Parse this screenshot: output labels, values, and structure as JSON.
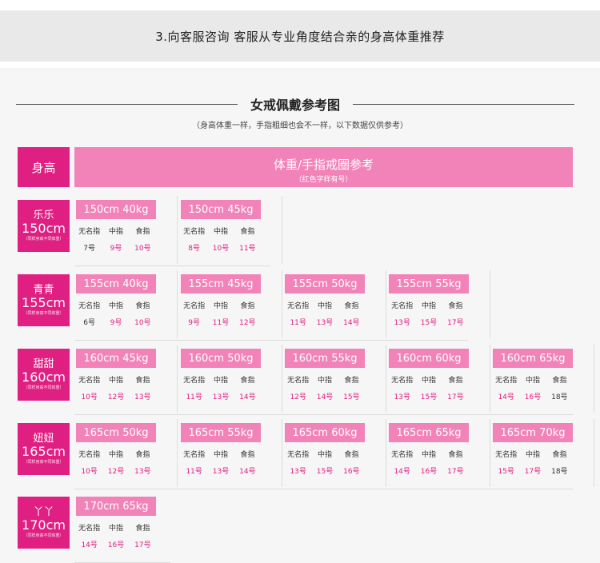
{
  "header": {
    "title": "3.向客服咨询 客服从专业角度结合亲的身高体重推荐"
  },
  "chart": {
    "title": "女戒佩戴参考图",
    "subtitle": "（身高体重一样，手指粗细也会不一样，以下数据仅供参考）",
    "head_left": "身高",
    "head_right": "体重/手指戒圈参考",
    "head_right_sub": "（红色字样有号）",
    "finger_labels": [
      "无名指",
      "中指",
      "食指"
    ],
    "rows": [
      {
        "name": "乐乐",
        "height": "150cm",
        "note": "（同样身高不同体重）",
        "cells": [
          {
            "tag": "150cm 40kg",
            "values": [
              "7号",
              "9号",
              "10号"
            ],
            "red": [
              false,
              true,
              true
            ]
          },
          {
            "tag": "150cm 45kg",
            "values": [
              "8号",
              "10号",
              "11号"
            ],
            "red": [
              true,
              true,
              true
            ]
          }
        ]
      },
      {
        "name": "青青",
        "height": "155cm",
        "note": "（同样身高不同体重）",
        "cells": [
          {
            "tag": "155cm 40kg",
            "values": [
              "6号",
              "9号",
              "10号"
            ],
            "red": [
              false,
              true,
              true
            ]
          },
          {
            "tag": "155cm 45kg",
            "values": [
              "9号",
              "11号",
              "12号"
            ],
            "red": [
              true,
              true,
              true
            ]
          },
          {
            "tag": "155cm 50kg",
            "values": [
              "11号",
              "13号",
              "14号"
            ],
            "red": [
              true,
              true,
              true
            ]
          },
          {
            "tag": "155cm 55kg",
            "values": [
              "13号",
              "15号",
              "17号"
            ],
            "red": [
              true,
              true,
              true
            ]
          }
        ]
      },
      {
        "name": "甜甜",
        "height": "160cm",
        "note": "（同样身高不同体重）",
        "cells": [
          {
            "tag": "160cm 45kg",
            "values": [
              "10号",
              "12号",
              "13号"
            ],
            "red": [
              true,
              true,
              true
            ]
          },
          {
            "tag": "160cm 50kg",
            "values": [
              "11号",
              "13号",
              "14号"
            ],
            "red": [
              true,
              true,
              true
            ]
          },
          {
            "tag": "160cm 55kg",
            "values": [
              "12号",
              "14号",
              "15号"
            ],
            "red": [
              true,
              true,
              true
            ]
          },
          {
            "tag": "160cm 60kg",
            "values": [
              "13号",
              "15号",
              "17号"
            ],
            "red": [
              true,
              true,
              true
            ]
          },
          {
            "tag": "160cm 65kg",
            "values": [
              "14号",
              "16号",
              "18号"
            ],
            "red": [
              true,
              true,
              false
            ]
          }
        ]
      },
      {
        "name": "妞妞",
        "height": "165cm",
        "note": "（同样身高不同体重）",
        "cells": [
          {
            "tag": "165cm 50kg",
            "values": [
              "10号",
              "12号",
              "13号"
            ],
            "red": [
              true,
              true,
              true
            ]
          },
          {
            "tag": "165cm 55kg",
            "values": [
              "11号",
              "13号",
              "14号"
            ],
            "red": [
              true,
              true,
              true
            ]
          },
          {
            "tag": "165cm 60kg",
            "values": [
              "13号",
              "15号",
              "16号"
            ],
            "red": [
              true,
              true,
              true
            ]
          },
          {
            "tag": "165cm 65kg",
            "values": [
              "14号",
              "16号",
              "17号"
            ],
            "red": [
              true,
              true,
              true
            ]
          },
          {
            "tag": "165cm 70kg",
            "values": [
              "15号",
              "17号",
              "18号"
            ],
            "red": [
              true,
              true,
              false
            ]
          }
        ]
      },
      {
        "name": "丫丫",
        "height": "170cm",
        "note": "（同样身高不同体重）",
        "cells": [
          {
            "tag": "170cm 65kg",
            "values": [
              "14号",
              "16号",
              "17号"
            ],
            "red": [
              true,
              true,
              true
            ]
          }
        ]
      }
    ]
  },
  "colors": {
    "pink_dark": "#e01f82",
    "pink_light": "#f283b8",
    "text_red": "#e01f82"
  }
}
